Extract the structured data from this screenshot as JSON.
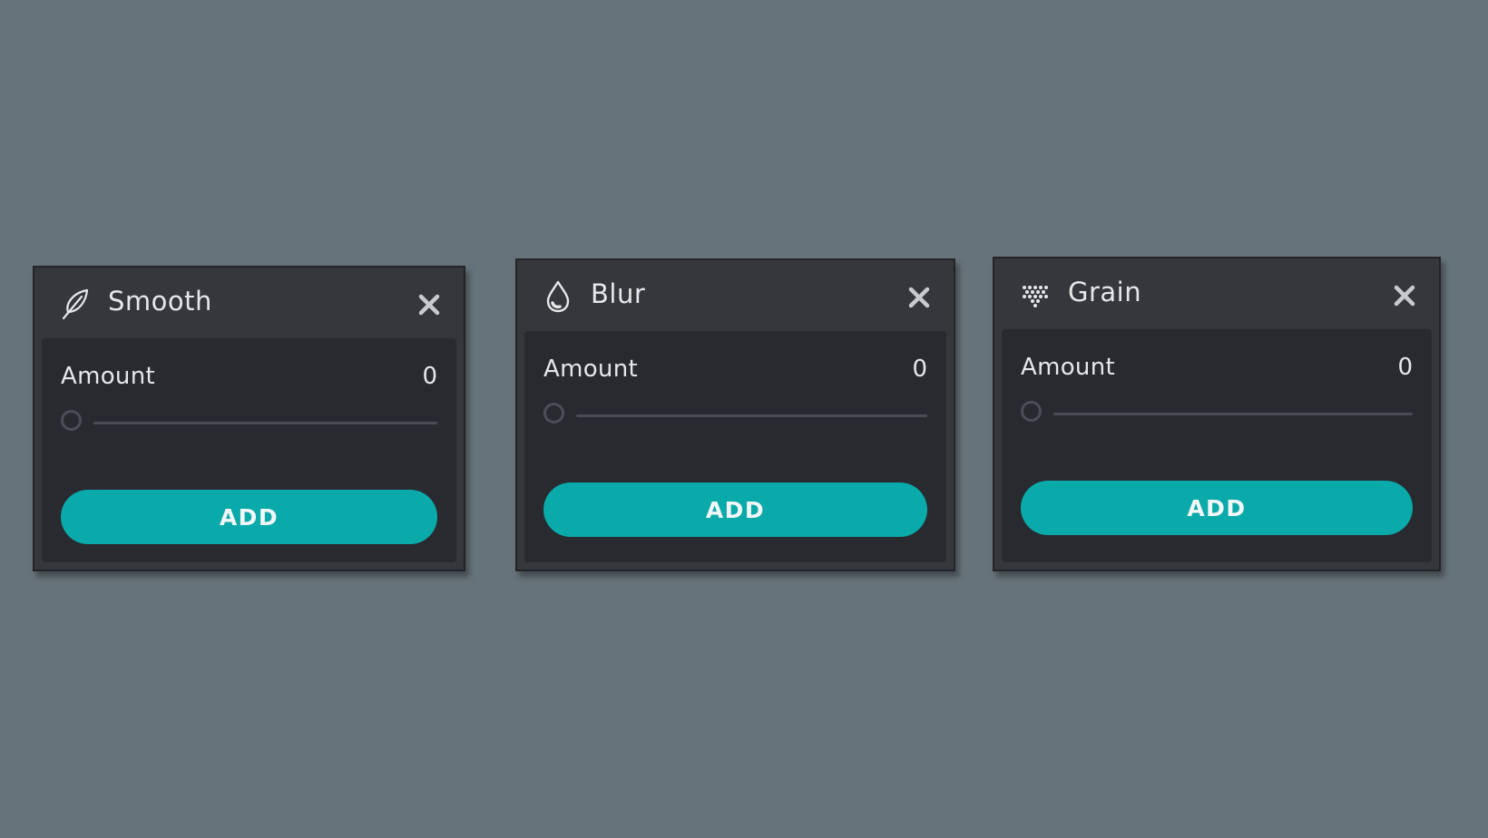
{
  "colors": {
    "background": "#66737a",
    "panel": "#35373c",
    "panel_body": "#282a30",
    "accent": "#0aa9aa",
    "text": "#e6e7e9"
  },
  "panels": [
    {
      "title": "Smooth",
      "icon": "feather-icon",
      "amount_label": "Amount",
      "amount_value": "0",
      "slider_fraction": 0,
      "button_label": "ADD"
    },
    {
      "title": "Blur",
      "icon": "droplet-icon",
      "amount_label": "Amount",
      "amount_value": "0",
      "slider_fraction": 0,
      "button_label": "ADD"
    },
    {
      "title": "Grain",
      "icon": "grain-dots-icon",
      "amount_label": "Amount",
      "amount_value": "0",
      "slider_fraction": 0,
      "button_label": "ADD"
    }
  ]
}
